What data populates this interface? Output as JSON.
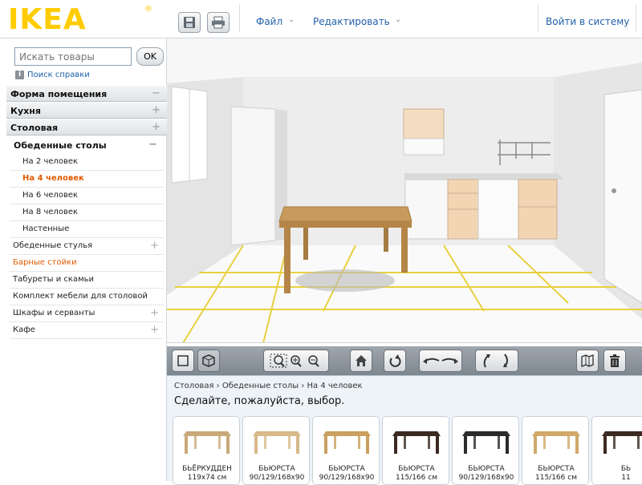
{
  "logo": {
    "text": "IKEA",
    "reg": "®",
    "color": "#ffcc00"
  },
  "header": {
    "menu_file": "Файл",
    "menu_edit": "Редактировать",
    "login": "Войти в систему"
  },
  "sidebar": {
    "search_placeholder": "Искать товары",
    "ok_label": "OK",
    "help_label": "Поиск справки",
    "categories": [
      {
        "label": "Форма помещения",
        "sign": "−"
      },
      {
        "label": "Кухня",
        "sign": "+"
      },
      {
        "label": "Столовая",
        "sign": "+"
      }
    ],
    "subcategory": {
      "label": "Обеденные столы",
      "sign": "−"
    },
    "items": [
      {
        "label": "На 2 человек"
      },
      {
        "label": "На 4 человек"
      },
      {
        "label": "На 6 человек"
      },
      {
        "label": "На 8 человек"
      },
      {
        "label": "Настенные"
      }
    ],
    "more": [
      {
        "label": "Обеденные стулья",
        "sign": "+"
      },
      {
        "label": "Барные стойки",
        "sign": ""
      },
      {
        "label": "Табуреты и скамьи",
        "sign": ""
      },
      {
        "label": "Комплект мебели для столовой",
        "sign": ""
      },
      {
        "label": "Шкафы и серванты",
        "sign": "+"
      },
      {
        "label": "Кафе",
        "sign": "+"
      }
    ]
  },
  "catalog": {
    "breadcrumb_1": "Столовая",
    "breadcrumb_2": "Обеденные столы",
    "breadcrumb_3": "На 4 человек",
    "title": "Сделайте, пожалуйста, выбор.",
    "products": [
      {
        "name": "БЬЁРКУДДЕН",
        "size": "119x74 см",
        "color": "#c9a97a"
      },
      {
        "name": "БЬЮРСТА",
        "size": "90/129/168x90",
        "color": "#d8b98a"
      },
      {
        "name": "БЬЮРСТА",
        "size": "90/129/168x90",
        "color": "#c9a060"
      },
      {
        "name": "БЬЮРСТА",
        "size": "115/166 см",
        "color": "#3b2a22"
      },
      {
        "name": "БЬЮРСТА",
        "size": "90/129/168x90",
        "color": "#2b2b2b"
      },
      {
        "name": "БЬЮРСТА",
        "size": "115/166 см",
        "color": "#d0a868"
      },
      {
        "name": "БЬ",
        "size": "11",
        "color": "#3b2a22"
      }
    ]
  }
}
